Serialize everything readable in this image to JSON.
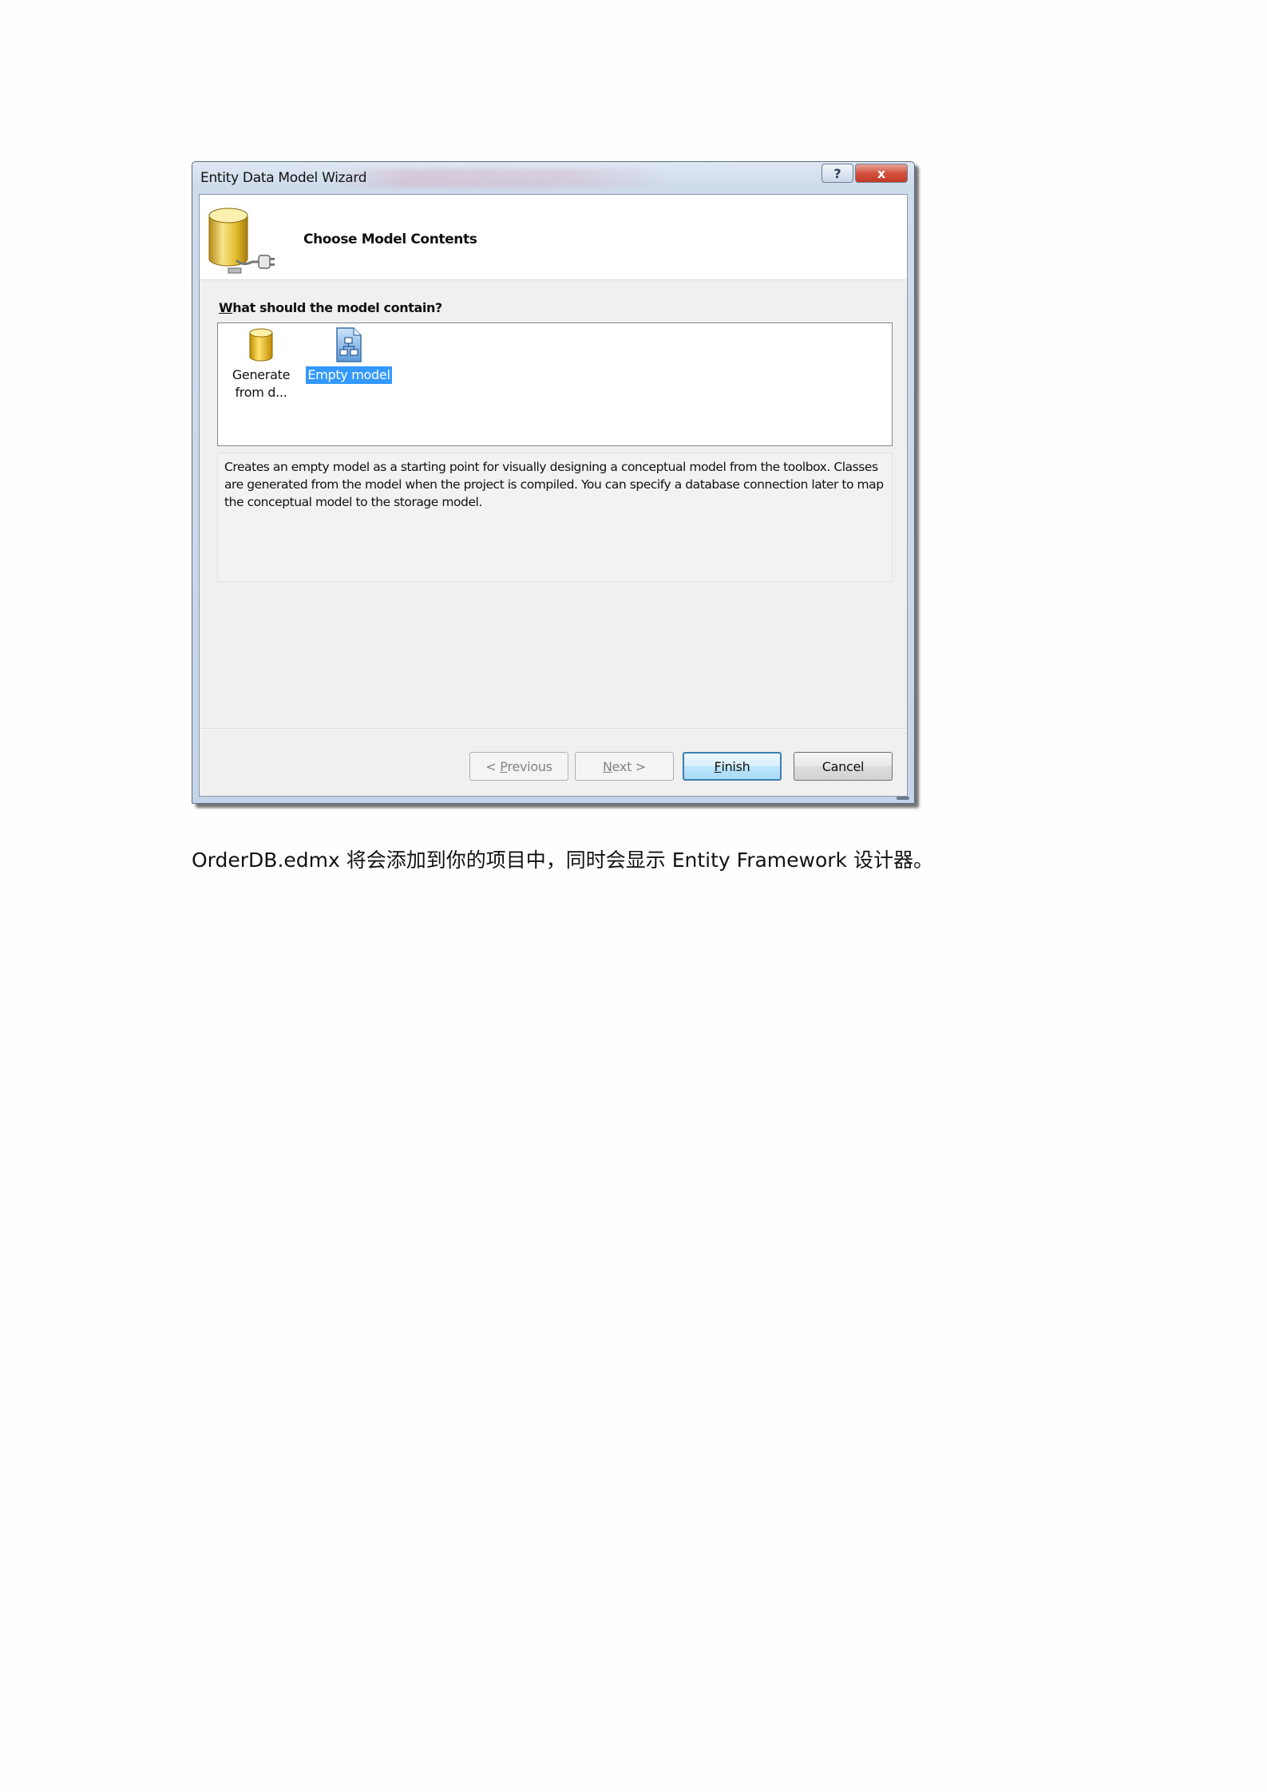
{
  "dialog": {
    "title": "Entity Data Model Wizard",
    "help_symbol": "?",
    "close_symbol": "x",
    "header_title": "Choose Model Contents",
    "prompt_label_mnemonic": "W",
    "prompt_label_rest": "hat should the model contain?",
    "options": [
      {
        "label": "Generate from d...",
        "icon": "database-icon",
        "selected": false
      },
      {
        "label": "Empty model",
        "icon": "empty-model-icon",
        "selected": true
      }
    ],
    "description": "Creates an empty model as a starting point for visually designing a conceptual model from the toolbox. Classes are generated from the model when the project is compiled. You can specify a database connection later to map the conceptual model to the storage model.",
    "buttons": {
      "previous": {
        "prefix": "< ",
        "mnemonic": "P",
        "rest": "revious",
        "enabled": false
      },
      "next": {
        "mnemonic": "N",
        "rest": "ext >",
        "enabled": false
      },
      "finish": {
        "mnemonic": "F",
        "rest": "inish",
        "enabled": true
      },
      "cancel": {
        "label": "Cancel",
        "enabled": true
      }
    }
  },
  "caption": {
    "filename": "OrderDB.edmx",
    "text_cn_1": "将会添加到你的项目中，同时会显示",
    "framework": " Entity Framework ",
    "text_cn_2": "设计器。"
  }
}
